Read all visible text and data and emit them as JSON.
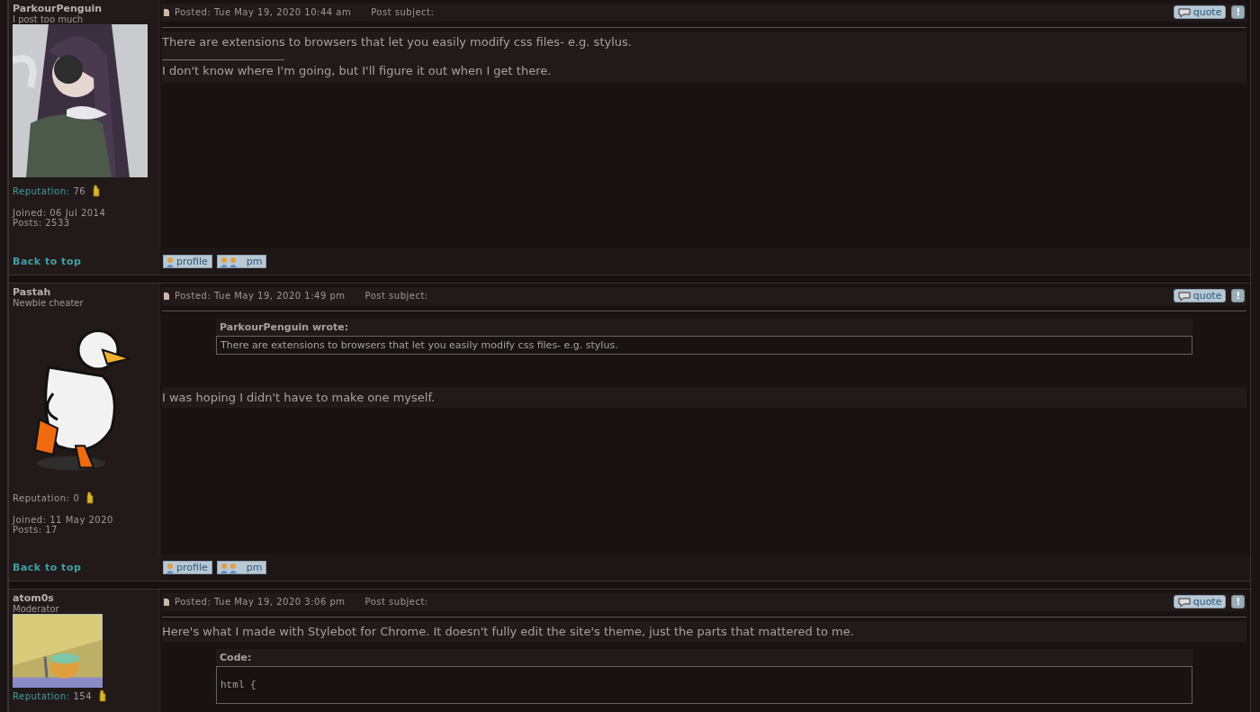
{
  "posts": [
    {
      "author": "ParkourPenguin",
      "rank": "I post too much",
      "avatar": {
        "kind": "picture"
      },
      "reputation_label": "Reputation:",
      "reputation": "76",
      "rep_highlight": true,
      "joined": "Joined: 06 Jul 2014",
      "post_count": "Posts: 2533",
      "posted": "Posted: Tue May 19, 2020 10:44 am",
      "subject_label": "Post subject:",
      "actions": [
        "quote",
        "!"
      ],
      "body": [
        {
          "kind": "text",
          "text": "There are extensions to browsers that let you easily modify css files- e.g. stylus."
        },
        {
          "kind": "signature",
          "text": "I don't know where I'm going, but I'll figure it out when I get there."
        }
      ],
      "footer": {
        "back": "Back to top",
        "buttons": [
          "profile",
          "pm"
        ]
      }
    },
    {
      "author": "Pastah",
      "rank": "Newbie cheater",
      "avatar": {
        "kind": "picture"
      },
      "reputation_label": "Reputation:",
      "reputation": "0",
      "rep_highlight": false,
      "joined": "Joined: 11 May 2020",
      "post_count": "Posts: 17",
      "posted": "Posted: Tue May 19, 2020 1:49 pm",
      "subject_label": "Post subject:",
      "actions": [
        "quote",
        "!"
      ],
      "body": [
        {
          "kind": "quote",
          "author": "ParkourPenguin wrote:",
          "text": "There are extensions to browsers that let you easily modify css files- e.g. stylus."
        },
        {
          "kind": "text",
          "text": "I was hoping I didn't have to make one myself."
        }
      ],
      "footer": {
        "back": "Back to top",
        "buttons": [
          "profile",
          "pm"
        ]
      }
    },
    {
      "author": "atom0s",
      "rank": "Moderator",
      "avatar": {
        "kind": "picture"
      },
      "reputation_label": "Reputation:",
      "reputation": "154",
      "rep_highlight": true,
      "posted": "Posted: Tue May 19, 2020 3:06 pm",
      "subject_label": "Post subject:",
      "actions": [
        "quote",
        "!"
      ],
      "body": [
        {
          "kind": "text",
          "text": "Here's what I made with Stylebot for Chrome. It doesn't fully edit the site's theme, just the parts that mattered to me."
        },
        {
          "kind": "code",
          "label": "Code:",
          "lines": [
            "html {"
          ]
        }
      ]
    }
  ]
}
